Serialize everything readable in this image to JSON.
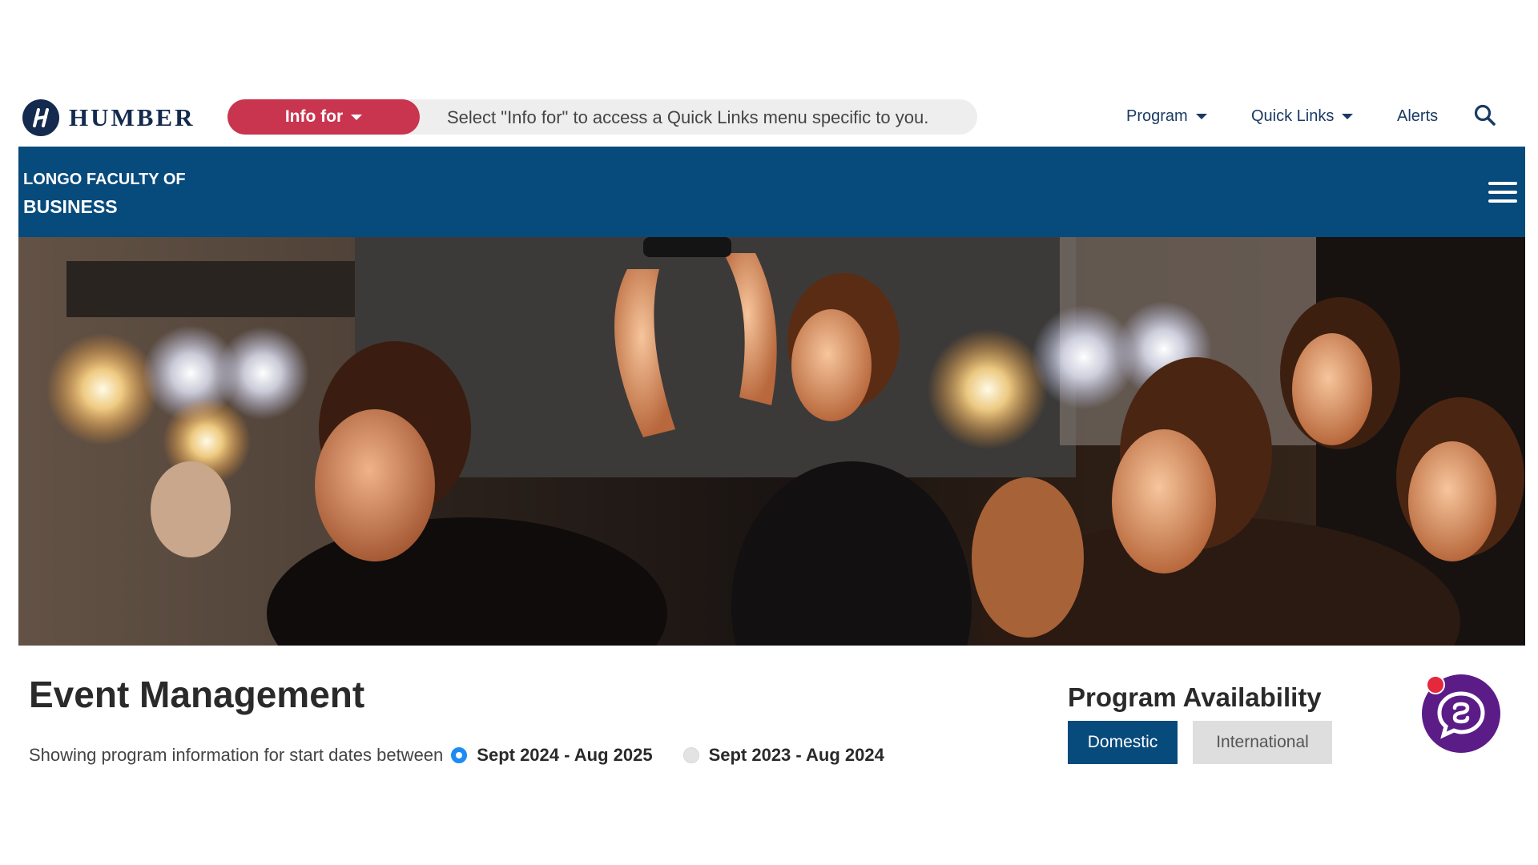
{
  "brand": {
    "name": "HUMBER"
  },
  "info_for": {
    "button_label": "Info for",
    "hint": "Select \"Info for\" to access a Quick Links menu specific to you."
  },
  "topnav": {
    "items": [
      {
        "label": "Program"
      },
      {
        "label": "Quick Links"
      },
      {
        "label": "Alerts"
      }
    ]
  },
  "faculty": {
    "line1": "LONGO FACULTY OF",
    "line2": "BUSINESS"
  },
  "program": {
    "title": "Event Management",
    "dates_prefix": "Showing program information for start dates between",
    "date_options": [
      {
        "label": "Sept 2024 - Aug 2025",
        "selected": true
      },
      {
        "label": "Sept 2023 - Aug 2024",
        "selected": false
      }
    ]
  },
  "availability": {
    "title": "Program Availability",
    "options": [
      {
        "label": "Domestic",
        "selected": true
      },
      {
        "label": "International",
        "selected": false
      }
    ]
  },
  "colors": {
    "brand_navy": "#142a4e",
    "info_red": "#c9344f",
    "faculty_blue": "#074a7c",
    "chat_purple": "#5b1c88",
    "radio_blue": "#1d8cf2"
  },
  "icons": {
    "logo": "humber-logo-icon",
    "search": "search-icon",
    "menu": "hamburger-menu-icon",
    "chat": "chat-icon"
  }
}
